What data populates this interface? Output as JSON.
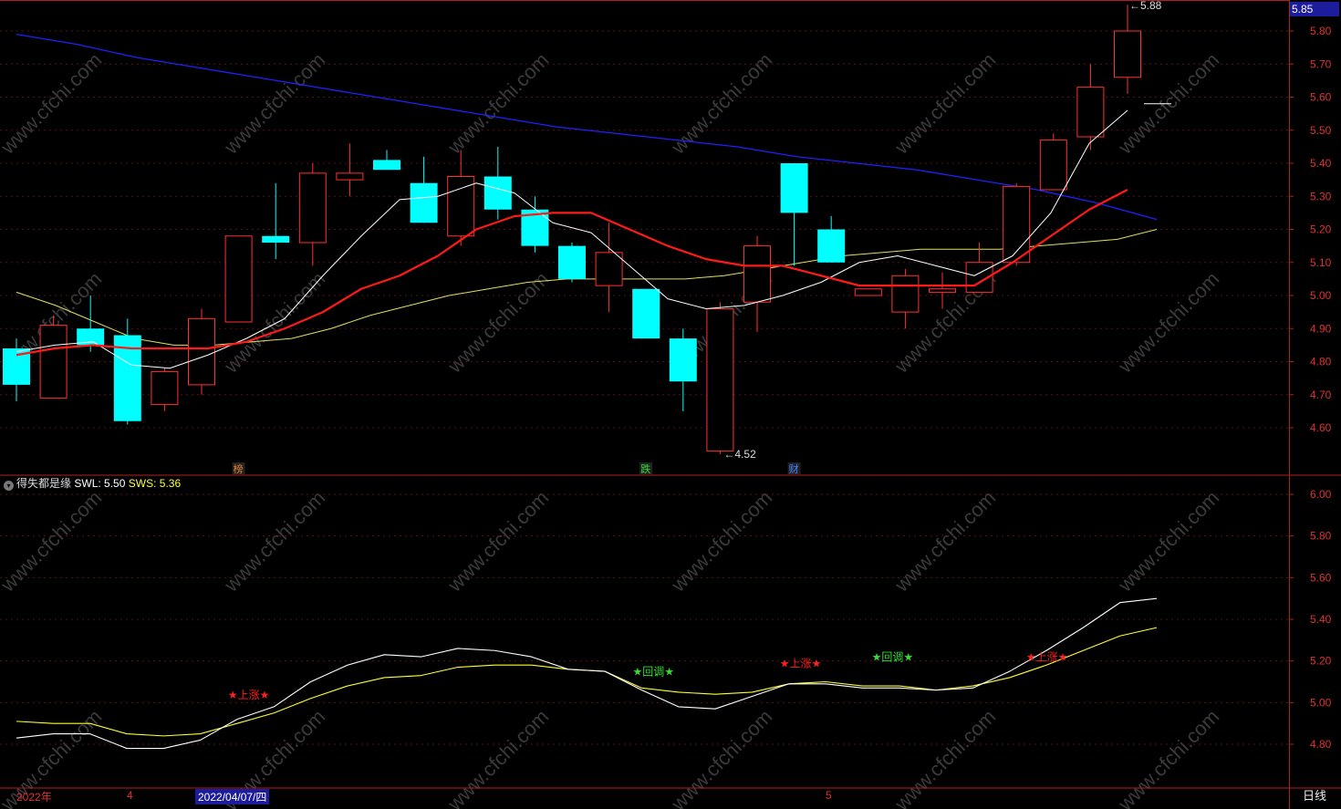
{
  "chart_data": [
    {
      "type": "candlestick",
      "panel": "main",
      "ylim": [
        4.5,
        5.9
      ],
      "y_ticks": [
        "5.80",
        "5.70",
        "5.60",
        "5.50",
        "5.40",
        "5.30",
        "5.20",
        "5.10",
        "5.00",
        "4.90",
        "4.80",
        "4.70",
        "4.60"
      ],
      "current_price": "5.85",
      "colors": {
        "up": "#ff3030",
        "down": "#00ffff",
        "ma_white": "#ffffff",
        "ma_red": "#ff1a1a",
        "ma_yellow": "#e0e060",
        "ma_blue": "#2020ff"
      },
      "candles": [
        {
          "o": 4.84,
          "h": 4.87,
          "l": 4.68,
          "c": 4.73
        },
        {
          "o": 4.69,
          "h": 4.94,
          "l": 4.69,
          "c": 4.91
        },
        {
          "o": 4.9,
          "h": 5.0,
          "l": 4.83,
          "c": 4.85
        },
        {
          "o": 4.88,
          "h": 4.93,
          "l": 4.61,
          "c": 4.62
        },
        {
          "o": 4.67,
          "h": 4.78,
          "l": 4.65,
          "c": 4.77
        },
        {
          "o": 4.73,
          "h": 4.96,
          "l": 4.7,
          "c": 4.93
        },
        {
          "o": 4.92,
          "h": 5.18,
          "l": 4.92,
          "c": 5.18
        },
        {
          "o": 5.18,
          "h": 5.34,
          "l": 5.11,
          "c": 5.16
        },
        {
          "o": 5.16,
          "h": 5.4,
          "l": 5.09,
          "c": 5.37
        },
        {
          "o": 5.35,
          "h": 5.46,
          "l": 5.3,
          "c": 5.37
        },
        {
          "o": 5.41,
          "h": 5.44,
          "l": 5.38,
          "c": 5.38
        },
        {
          "o": 5.34,
          "h": 5.42,
          "l": 5.22,
          "c": 5.22
        },
        {
          "o": 5.18,
          "h": 5.44,
          "l": 5.15,
          "c": 5.36
        },
        {
          "o": 5.36,
          "h": 5.45,
          "l": 5.23,
          "c": 5.26
        },
        {
          "o": 5.26,
          "h": 5.3,
          "l": 5.13,
          "c": 5.15
        },
        {
          "o": 5.15,
          "h": 5.16,
          "l": 5.04,
          "c": 5.05
        },
        {
          "o": 5.03,
          "h": 5.22,
          "l": 4.95,
          "c": 5.13
        },
        {
          "o": 5.02,
          "h": 5.02,
          "l": 4.87,
          "c": 4.87
        },
        {
          "o": 4.87,
          "h": 4.9,
          "l": 4.65,
          "c": 4.74
        },
        {
          "o": 4.53,
          "h": 4.98,
          "l": 4.52,
          "c": 4.96
        },
        {
          "o": 4.98,
          "h": 5.18,
          "l": 4.89,
          "c": 5.15
        },
        {
          "o": 5.4,
          "h": 5.4,
          "l": 5.09,
          "c": 5.25
        },
        {
          "o": 5.2,
          "h": 5.24,
          "l": 5.1,
          "c": 5.1
        },
        {
          "o": 5.0,
          "h": 5.02,
          "l": 5.0,
          "c": 5.02
        },
        {
          "o": 4.95,
          "h": 5.08,
          "l": 4.9,
          "c": 5.06
        },
        {
          "o": 5.01,
          "h": 5.07,
          "l": 4.96,
          "c": 5.02
        },
        {
          "o": 5.01,
          "h": 5.16,
          "l": 5.01,
          "c": 5.1
        },
        {
          "o": 5.1,
          "h": 5.34,
          "l": 5.09,
          "c": 5.33
        },
        {
          "o": 5.32,
          "h": 5.49,
          "l": 5.32,
          "c": 5.47
        },
        {
          "o": 5.48,
          "h": 5.7,
          "l": 5.44,
          "c": 5.63
        },
        {
          "o": 5.66,
          "h": 5.88,
          "l": 5.61,
          "c": 5.8
        }
      ],
      "ma_white": [
        4.83,
        4.85,
        4.86,
        4.79,
        4.78,
        4.82,
        4.87,
        4.93,
        5.06,
        5.18,
        5.29,
        5.3,
        5.34,
        5.31,
        5.22,
        5.19,
        5.09,
        4.99,
        4.96,
        4.97,
        5.0,
        5.04,
        5.1,
        5.12,
        5.09,
        5.06,
        5.12,
        5.25,
        5.46,
        5.56
      ],
      "ma_red": [
        4.82,
        4.84,
        4.85,
        4.84,
        4.84,
        4.84,
        4.86,
        4.9,
        4.95,
        5.02,
        5.06,
        5.12,
        5.2,
        5.24,
        5.25,
        5.25,
        5.2,
        5.15,
        5.11,
        5.09,
        5.09,
        5.06,
        5.03,
        5.03,
        5.03,
        5.03,
        5.1,
        5.18,
        5.26,
        5.32
      ],
      "ma_yellow": [
        5.01,
        4.97,
        4.92,
        4.87,
        4.85,
        4.85,
        4.86,
        4.87,
        4.9,
        4.94,
        4.97,
        5.0,
        5.02,
        5.04,
        5.05,
        5.05,
        5.05,
        5.05,
        5.06,
        5.08,
        5.1,
        5.12,
        5.13,
        5.14,
        5.14,
        5.14,
        5.15,
        5.16,
        5.17,
        5.2
      ],
      "ma_blue": [
        5.79,
        5.76,
        5.72,
        5.69,
        5.66,
        5.63,
        5.6,
        5.57,
        5.54,
        5.51,
        5.49,
        5.47,
        5.45,
        5.42,
        5.4,
        5.38,
        5.35,
        5.32,
        5.28,
        5.23
      ],
      "annotations": {
        "high_label": "5.88",
        "low_label": "4.52",
        "arrow_left": "←",
        "arrow_right": "←"
      },
      "event_tags": [
        {
          "candle": 6,
          "text": "榜",
          "color": "#e08030"
        },
        {
          "candle": 17,
          "text": "跌",
          "color": "#30e030"
        },
        {
          "candle": 21,
          "text": "财",
          "color": "#4080ff"
        }
      ]
    },
    {
      "type": "line",
      "panel": "indicator",
      "title": "得失都是缘",
      "ylim": [
        4.7,
        6.1
      ],
      "y_ticks": [
        "6.00",
        "5.80",
        "5.60",
        "5.40",
        "5.20",
        "5.00",
        "4.80"
      ],
      "series": [
        {
          "name": "SWL",
          "value_label": "5.50",
          "color": "#ffffff",
          "values": [
            4.83,
            4.85,
            4.85,
            4.78,
            4.78,
            4.82,
            4.92,
            4.98,
            5.1,
            5.18,
            5.23,
            5.22,
            5.26,
            5.25,
            5.22,
            5.16,
            5.15,
            5.06,
            4.98,
            4.97,
            5.03,
            5.09,
            5.09,
            5.07,
            5.07,
            5.06,
            5.07,
            5.15,
            5.25,
            5.36,
            5.48,
            5.5
          ]
        },
        {
          "name": "SWS",
          "value_label": "5.36",
          "color": "#ffff33",
          "values": [
            4.91,
            4.9,
            4.9,
            4.85,
            4.84,
            4.85,
            4.9,
            4.95,
            5.02,
            5.08,
            5.12,
            5.13,
            5.17,
            5.18,
            5.18,
            5.16,
            5.15,
            5.07,
            5.05,
            5.04,
            5.05,
            5.09,
            5.1,
            5.08,
            5.08,
            5.06,
            5.08,
            5.12,
            5.18,
            5.25,
            5.32,
            5.36
          ]
        }
      ],
      "signals": [
        {
          "text": "★上涨★",
          "x_idx": 6,
          "y": 5.02,
          "color": "#ff2020"
        },
        {
          "text": "★回调★",
          "x_idx": 17,
          "y": 5.13,
          "color": "#30e030"
        },
        {
          "text": "★上涨★",
          "x_idx": 21,
          "y": 5.17,
          "color": "#ff2020"
        },
        {
          "text": "★回调★",
          "x_idx": 23.5,
          "y": 5.2,
          "color": "#30e030"
        },
        {
          "text": "★上涨★",
          "x_idx": 27.7,
          "y": 5.2,
          "color": "#ff2020"
        }
      ]
    }
  ],
  "time_axis": {
    "labels": [
      "2022年",
      "4",
      "5"
    ],
    "selected_date": "2022/04/07/四",
    "period": "日线"
  },
  "watermark": "www.cfchi.com"
}
